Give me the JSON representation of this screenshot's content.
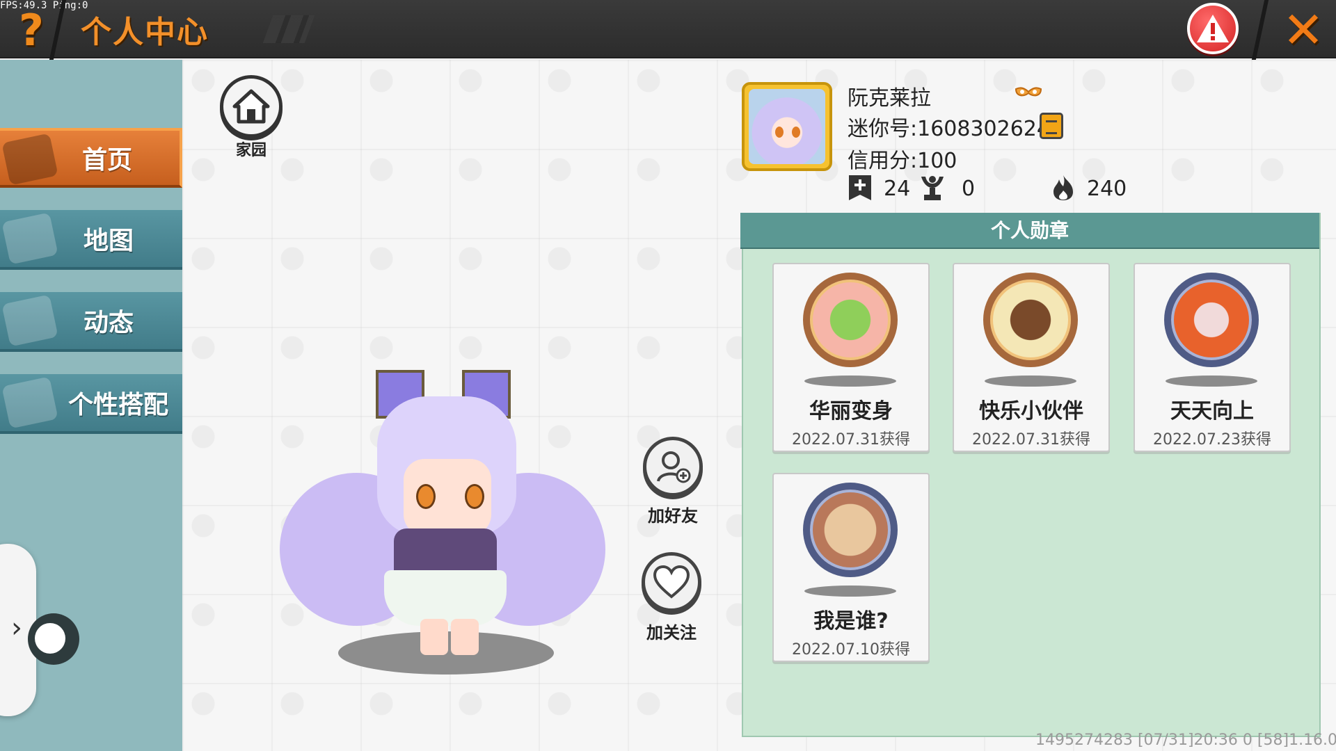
{
  "overlay": {
    "fps": "FPS:49.3  Ping:0"
  },
  "header": {
    "title": "个人中心",
    "help_icon": "question-mark-icon",
    "warning_icon": "warning-triangle-icon",
    "close_icon": "close-x-icon",
    "colors": {
      "title": "#f3902a",
      "warning": "#d52424",
      "close": "#f27b16"
    }
  },
  "sidebar": {
    "items": [
      {
        "label": "首页",
        "icon": "home-house-icon",
        "active": true
      },
      {
        "label": "地图",
        "icon": "map-icon",
        "active": false
      },
      {
        "label": "动态",
        "icon": "bell-icon",
        "active": false
      },
      {
        "label": "个性搭配",
        "icon": "outfit-icon",
        "active": false
      }
    ],
    "drawer_icon": "chevron-right-icon"
  },
  "home": {
    "label": "家园",
    "icon": "house-icon"
  },
  "actions": {
    "add_friend": {
      "label": "加好友",
      "icon": "add-user-icon"
    },
    "follow": {
      "label": "加关注",
      "icon": "heart-icon"
    }
  },
  "profile": {
    "name": "阮克莱拉",
    "mini_id": "迷你号:1608302624",
    "credit": "信用分:100",
    "stats": [
      {
        "icon": "plus-bookmark-icon",
        "value": "24"
      },
      {
        "icon": "trophy-cup-icon",
        "value": "0"
      },
      {
        "icon": "flame-icon",
        "value": "240"
      }
    ]
  },
  "badges": {
    "title": "个人勋章",
    "items": [
      {
        "name": "华丽变身",
        "date": "2022.07.31获得",
        "style": "bronze"
      },
      {
        "name": "快乐小伙伴",
        "date": "2022.07.31获得",
        "style": "bronze"
      },
      {
        "name": "天天向上",
        "date": "2022.07.23获得",
        "style": "blue"
      },
      {
        "name": "我是谁?",
        "date": "2022.07.10获得",
        "style": "blue"
      }
    ]
  },
  "footer": {
    "info": "1495274283   [07/31]20:36 0  [58]1.16.0"
  }
}
